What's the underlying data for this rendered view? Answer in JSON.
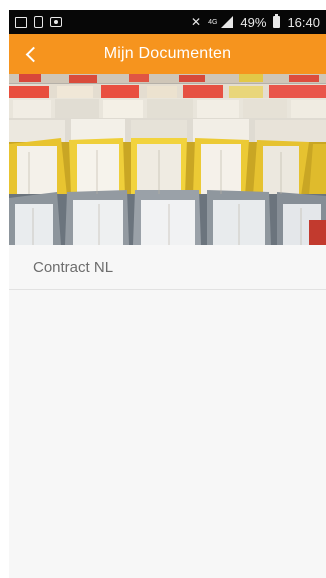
{
  "status_bar": {
    "left_icons": [
      "gallery-icon",
      "phone-notification-icon",
      "camera-icon"
    ],
    "network_type": "4G",
    "battery_percent": "49%",
    "time": "16:40"
  },
  "app_bar": {
    "title": "Mijn Documenten",
    "back_icon": "chevron-left-icon",
    "color": "#f6941e"
  },
  "documents": [
    {
      "label": "Contract NL"
    }
  ]
}
